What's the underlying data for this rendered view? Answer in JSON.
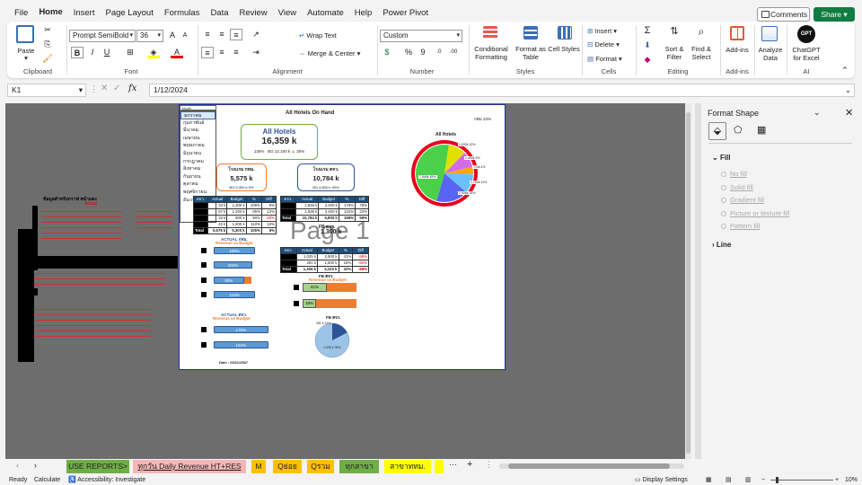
{
  "menu": {
    "items": [
      "File",
      "Home",
      "Insert",
      "Page Layout",
      "Formulas",
      "Data",
      "Review",
      "View",
      "Automate",
      "Help",
      "Power Pivot"
    ],
    "comments": "Comments",
    "share": "Share"
  },
  "ribbon": {
    "clipboard": {
      "paste": "Paste",
      "label": "Clipboard"
    },
    "font": {
      "name": "Prompt SemiBold",
      "size": "36",
      "label": "Font"
    },
    "alignment": {
      "wrap": "Wrap Text",
      "merge": "Merge & Center",
      "label": "Alignment"
    },
    "number": {
      "format": "Custom",
      "label": "Number"
    },
    "styles": {
      "conditional": "Conditional Formatting",
      "format_table": "Format as Table",
      "cell_styles": "Cell Styles",
      "label": "Styles"
    },
    "cells": {
      "insert": "Insert",
      "delete": "Delete",
      "format": "Format",
      "label": "Cells"
    },
    "editing": {
      "sort": "Sort & Filter",
      "find": "Find & Select",
      "label": "Editing"
    },
    "addins": {
      "addins": "Add-ins",
      "label": "Add-ins"
    },
    "analyze": {
      "label": "Analyze Data"
    },
    "ai": {
      "chatgpt": "ChatGPT for Excel",
      "label": "AI",
      "gpt": "GPT"
    }
  },
  "formula_bar": {
    "name_box": "K1",
    "value": "1/12/2024",
    "fx": "fx"
  },
  "page": {
    "title": "All Hotels On Hand",
    "pct_label": "กคม 34%",
    "watermark": "Page 1",
    "all_hotels": {
      "title": "All Hotels",
      "value": "16,359 k",
      "pct": "135%",
      "bg": "BG 12,100 k",
      "diff": "35%"
    },
    "hotel1": {
      "title": "โรงแรม กทม.",
      "value": "5,575 k",
      "bg": "BG 5,300 k",
      "diff": "5%"
    },
    "hotel2": {
      "title": "โรงแรม ตจว.",
      "value": "10,784 k",
      "bg": "BG 6,800 k",
      "diff": "59%"
    },
    "fb1": {
      "title": "FB ตจว.",
      "value": "1,300 k"
    },
    "pie_title": "All Hotels",
    "pie_labels": [
      "1,632k 10%",
      "1,450k 9%",
      "724k 4%",
      "1,762k 11%",
      "2,908k 18%",
      "7,849k 48%"
    ],
    "months": [
      "มกราคม",
      "กุมภาพันธ์",
      "มีนาคม",
      "เมษายน",
      "พฤษภาคม",
      "มิถุนายน",
      "กรกฎาคม",
      "สิงหาคม",
      "กันยายน",
      "ตุลาคม",
      "พฤศจิกายน",
      "ธันวาคม"
    ],
    "dropdown_header": "Month",
    "table_headers": [
      "ตจว.",
      "Actual",
      "Budget",
      "%",
      "Diff"
    ],
    "table1_rows": [
      [
        "",
        "33 k",
        "1,300 k",
        "109%",
        "9%"
      ],
      [
        "",
        "57 k",
        "1,200 k",
        "95%",
        "12%"
      ],
      [
        "",
        "33 k",
        "900 k",
        "90%",
        "-20%"
      ],
      [
        "",
        "42 k",
        "1,800 k",
        "110%",
        "10%"
      ],
      [
        "Total",
        "5,575 k",
        "5,300 k",
        "105%",
        "5%"
      ]
    ],
    "table2_rows": [
      [
        "",
        "2,846 k",
        "2,400 k",
        "178%",
        "78%"
      ],
      [
        "",
        "2,935 k",
        "2,400 k",
        "122%",
        "22%"
      ],
      [
        "Total",
        "10,784 k",
        "6,800 k",
        "159%",
        "59%"
      ]
    ],
    "table3_rows": [
      [
        "",
        "1,025 k",
        "2,500 k",
        "41%",
        "-59%"
      ],
      [
        "",
        "281 k",
        "1,600 k",
        "18%",
        "-82%"
      ],
      [
        "Total",
        "1,306 k",
        "4,100 k",
        "32%",
        "-68%"
      ]
    ],
    "actual_bkk": "ACTUAL กทม.",
    "actual_up": "ACTUAL ตจว.",
    "revenue_vs_budget": "Revenue vs Budget",
    "bars_bkk": [
      "109%",
      "102%",
      "80%",
      "110%"
    ],
    "bars_up": [
      "178%",
      "122%"
    ],
    "fb2": {
      "title": "FB ตจว.",
      "subtitle": "Revenue vs Budget",
      "bars": [
        "41%",
        "18%"
      ]
    },
    "fb_pie_title": "FB ตจว.",
    "fb_pie_labels": [
      "281 k 22%",
      "1,025 k 78%"
    ],
    "date": "Date : 05/11/2567"
  },
  "left_sheet": {
    "title": "ข้อมูลสำหรับกราฟ หน้าแดง",
    "headers": [
      "Actual",
      "Budget",
      "Diff"
    ]
  },
  "format_pane": {
    "title": "Format Shape",
    "fill": "Fill",
    "options": [
      "No fill",
      "Solid fill",
      "Gradient fill",
      "Picture or texture fill",
      "Pattern fill"
    ],
    "line": "Line"
  },
  "tabs": [
    {
      "label": "USE REPORTS>",
      "color": "#70ad47"
    },
    {
      "label": "ทุกวัน Daily Revenue HT+RES",
      "color": "#f4b6b6"
    },
    {
      "label": "M",
      "color": "#ffc000"
    },
    {
      "label": "Qย่อย",
      "color": "#ffc000"
    },
    {
      "label": "Qรวม",
      "color": "#ffc000"
    },
    {
      "label": "ทุกสาขา",
      "color": "#70ad47"
    },
    {
      "label": "สาขาททม.",
      "color": "#ffff00"
    }
  ],
  "status": {
    "ready": "Ready",
    "calculate": "Calculate",
    "accessibility": "Accessibility: Investigate",
    "display": "Display Settings",
    "zoom": "10%"
  },
  "colors": {
    "accent": "#107c41",
    "page_border": "#1b2c9c",
    "pie": [
      "#ff3b1f",
      "#e0e000",
      "#6ac0ff",
      "#c66cf0",
      "#ffa500",
      "#5865f2",
      "#4ad04a"
    ]
  }
}
